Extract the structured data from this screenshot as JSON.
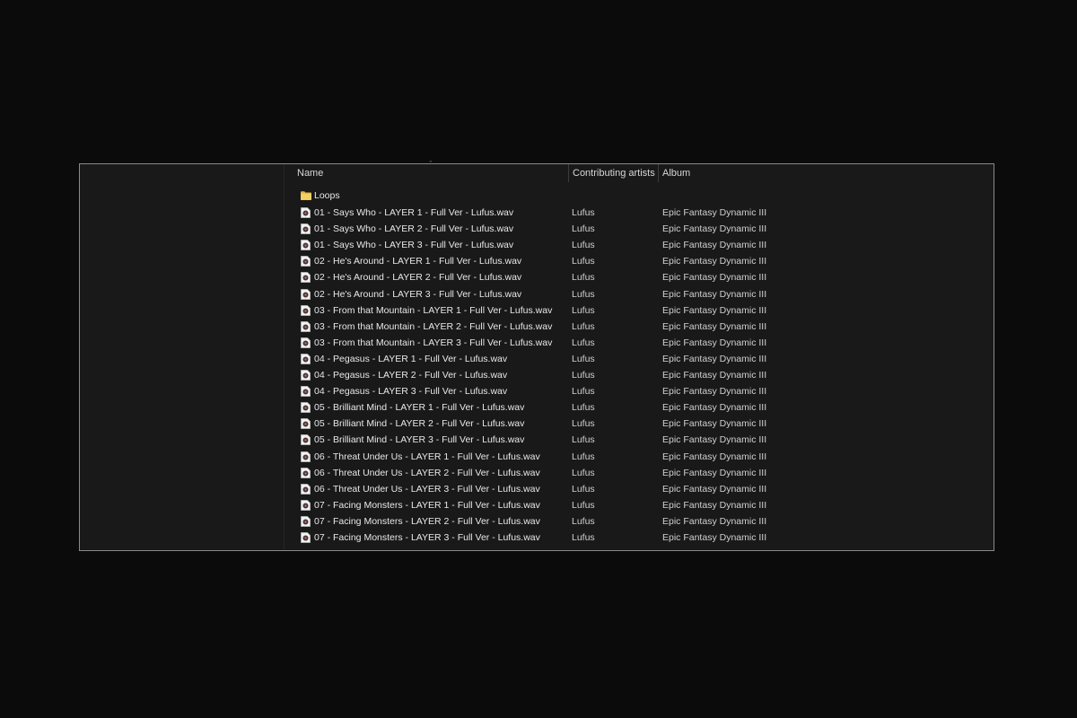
{
  "columns": {
    "name": "Name",
    "artists": "Contributing artists",
    "album": "Album"
  },
  "folder": {
    "name": "Loops",
    "icon": "folder-icon",
    "color": "#e8b84a"
  },
  "files": [
    {
      "name": "01 - Says Who - LAYER 1 - Full Ver - Lufus.wav",
      "artist": "Lufus",
      "album": "Epic Fantasy Dynamic III"
    },
    {
      "name": "01 - Says Who - LAYER 2 - Full Ver - Lufus.wav",
      "artist": "Lufus",
      "album": "Epic Fantasy Dynamic III"
    },
    {
      "name": "01 - Says Who - LAYER 3 - Full Ver - Lufus.wav",
      "artist": "Lufus",
      "album": "Epic Fantasy Dynamic III"
    },
    {
      "name": "02 - He's Around - LAYER 1 - Full Ver - Lufus.wav",
      "artist": "Lufus",
      "album": "Epic Fantasy Dynamic III"
    },
    {
      "name": "02 - He's Around - LAYER 2 - Full Ver - Lufus.wav",
      "artist": "Lufus",
      "album": "Epic Fantasy Dynamic III"
    },
    {
      "name": "02 - He's Around - LAYER 3 - Full Ver - Lufus.wav",
      "artist": "Lufus",
      "album": "Epic Fantasy Dynamic III"
    },
    {
      "name": "03 - From that Mountain - LAYER 1 - Full Ver - Lufus.wav",
      "artist": "Lufus",
      "album": "Epic Fantasy Dynamic III"
    },
    {
      "name": "03 - From that Mountain - LAYER 2 - Full Ver - Lufus.wav",
      "artist": "Lufus",
      "album": "Epic Fantasy Dynamic III"
    },
    {
      "name": "03 - From that Mountain - LAYER 3 - Full Ver - Lufus.wav",
      "artist": "Lufus",
      "album": "Epic Fantasy Dynamic III"
    },
    {
      "name": "04 - Pegasus - LAYER 1 - Full Ver - Lufus.wav",
      "artist": "Lufus",
      "album": "Epic Fantasy Dynamic III"
    },
    {
      "name": "04 - Pegasus - LAYER 2 - Full Ver - Lufus.wav",
      "artist": "Lufus",
      "album": "Epic Fantasy Dynamic III"
    },
    {
      "name": "04 - Pegasus - LAYER 3 - Full Ver - Lufus.wav",
      "artist": "Lufus",
      "album": "Epic Fantasy Dynamic III"
    },
    {
      "name": "05 - Brilliant Mind - LAYER 1 - Full Ver - Lufus.wav",
      "artist": "Lufus",
      "album": "Epic Fantasy Dynamic III"
    },
    {
      "name": "05 - Brilliant Mind - LAYER 2 - Full Ver - Lufus.wav",
      "artist": "Lufus",
      "album": "Epic Fantasy Dynamic III"
    },
    {
      "name": "05 - Brilliant Mind - LAYER 3 - Full Ver - Lufus.wav",
      "artist": "Lufus",
      "album": "Epic Fantasy Dynamic III"
    },
    {
      "name": "06 - Threat Under Us - LAYER 1 - Full Ver - Lufus.wav",
      "artist": "Lufus",
      "album": "Epic Fantasy Dynamic III"
    },
    {
      "name": "06 - Threat Under Us - LAYER 2 - Full Ver - Lufus.wav",
      "artist": "Lufus",
      "album": "Epic Fantasy Dynamic III"
    },
    {
      "name": "06 - Threat Under Us - LAYER 3 - Full Ver - Lufus.wav",
      "artist": "Lufus",
      "album": "Epic Fantasy Dynamic III"
    },
    {
      "name": "07 - Facing Monsters - LAYER 1 - Full Ver - Lufus.wav",
      "artist": "Lufus",
      "album": "Epic Fantasy Dynamic III"
    },
    {
      "name": "07 - Facing Monsters - LAYER 2 - Full Ver - Lufus.wav",
      "artist": "Lufus",
      "album": "Epic Fantasy Dynamic III"
    },
    {
      "name": "07 - Facing Monsters - LAYER 3 - Full Ver - Lufus.wav",
      "artist": "Lufus",
      "album": "Epic Fantasy Dynamic III"
    }
  ],
  "file_icon": "audio-file-icon",
  "sort_indicator_icon": "sort-caret-icon"
}
